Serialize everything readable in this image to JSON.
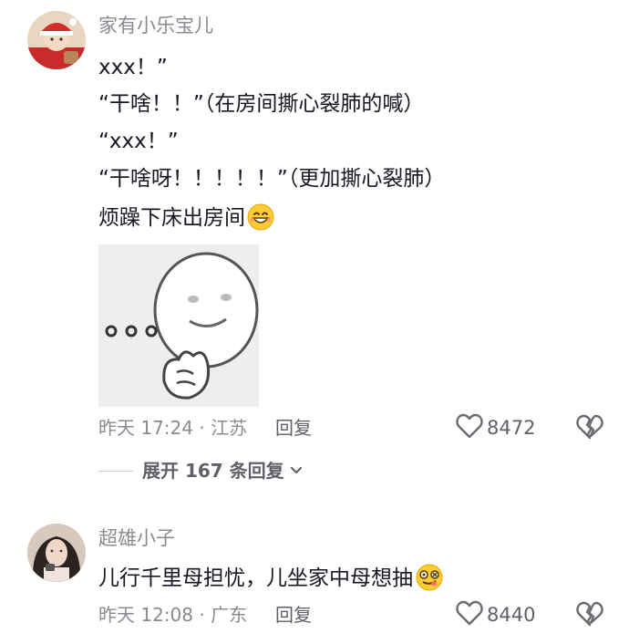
{
  "comments": [
    {
      "username": "家有小乐宝儿",
      "lines": [
        "xxx！”",
        "“干啥！！”（在房间撕心裂肺的喊）",
        "“xxx！”",
        "“干啥呀！！！！！”（更加撕心裂肺）",
        "烦躁下床出房间"
      ],
      "time_location": "昨天 17:24 · 江苏",
      "reply_label": "回复",
      "like_count": "8472",
      "expand_label": "展开 167 条回复"
    },
    {
      "username": "超雄小子",
      "lines": [
        "儿行千里母担忧，儿坐家中母想抽"
      ],
      "time_location": "昨天 12:08 · 广东",
      "reply_label": "回复",
      "like_count": "8440"
    }
  ],
  "icons": {
    "like": "heart-outline-icon",
    "dislike": "broken-heart-icon",
    "expand": "chevron-down-icon",
    "emoji_1": "grinning-smile-emoji",
    "emoji_2": "dizzy-face-emoji"
  },
  "colors": {
    "text_primary": "#161823",
    "text_secondary": "#8a8b91",
    "divider": "#c8c9cc"
  }
}
